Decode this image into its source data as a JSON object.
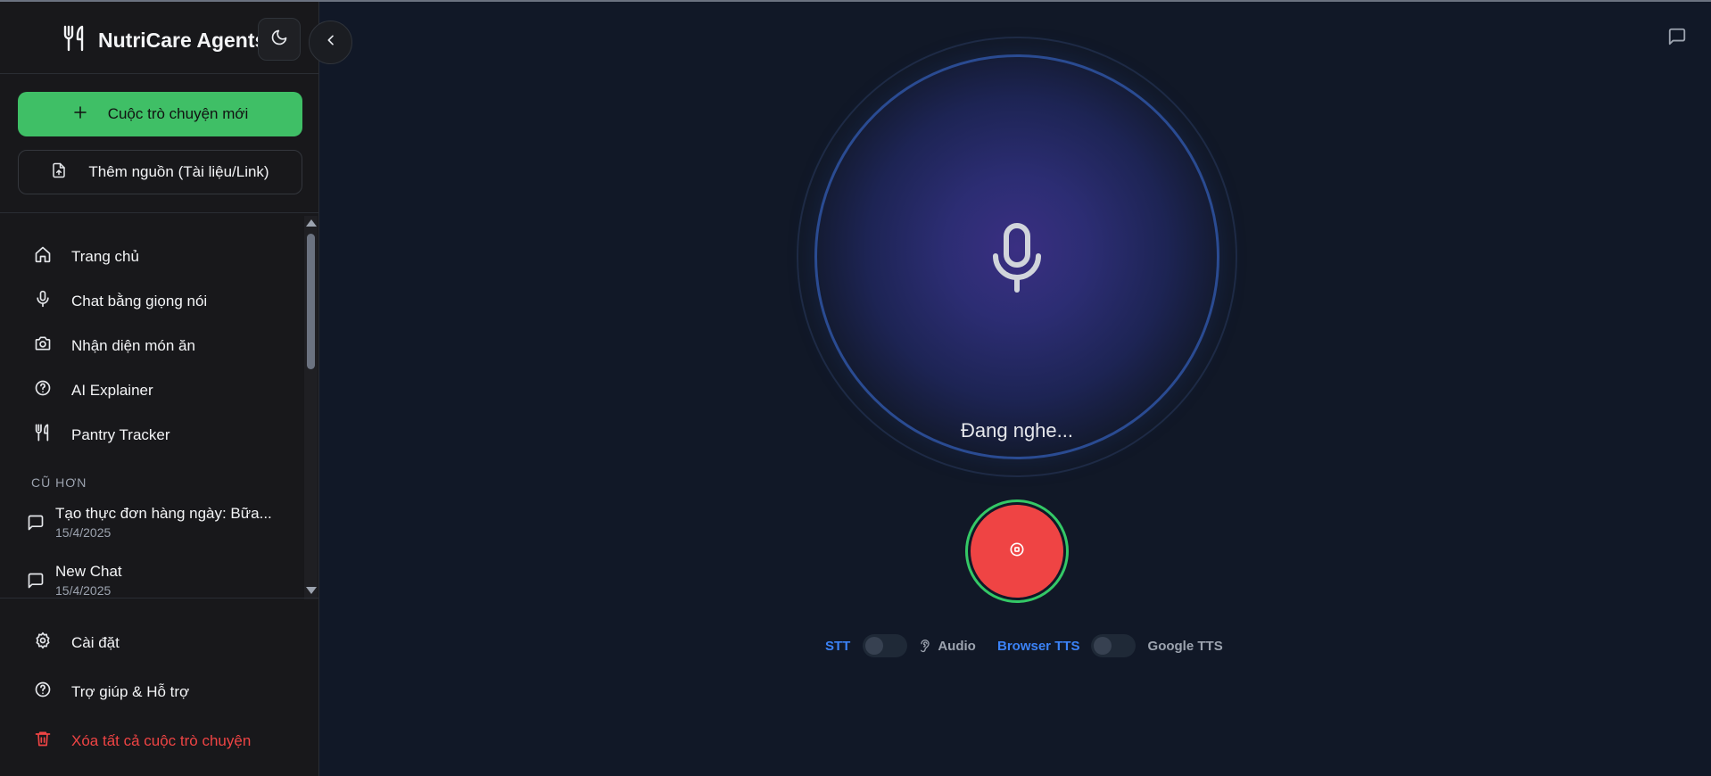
{
  "app": {
    "title": "NutriCare Agents"
  },
  "sidebar": {
    "new_chat_label": "Cuộc trò chuyện mới",
    "add_source_label": "Thêm nguồn (Tài liệu/Link)",
    "nav": [
      {
        "label": "Trang chủ",
        "icon": "home-icon"
      },
      {
        "label": "Chat bằng giọng nói",
        "icon": "microphone-icon"
      },
      {
        "label": "Nhận diện món ăn",
        "icon": "camera-icon"
      },
      {
        "label": "AI Explainer",
        "icon": "help-circle-icon"
      },
      {
        "label": "Pantry Tracker",
        "icon": "utensils-icon"
      }
    ],
    "section_older": "CŨ HƠN",
    "chats": [
      {
        "title": "Tạo thực đơn hàng ngày: Bữa...",
        "date": "15/4/2025"
      },
      {
        "title": "New Chat",
        "date": "15/4/2025"
      }
    ],
    "footer": [
      {
        "label": "Cài đặt",
        "icon": "settings-icon"
      },
      {
        "label": "Trợ giúp & Hỗ trợ",
        "icon": "help-circle-icon"
      },
      {
        "label": "Xóa tất cả cuộc trò chuyện",
        "icon": "trash-icon"
      }
    ]
  },
  "main": {
    "status_text": "Đang nghe...",
    "controls": {
      "stt_label": "STT",
      "audio_label": "Audio",
      "browser_tts_label": "Browser TTS",
      "google_tts_label": "Google TTS"
    }
  },
  "colors": {
    "background": "#111827",
    "sidebar": "#18181b",
    "accent_green": "#3fbf66",
    "record_red": "#ef4444",
    "accent_blue": "#3b82f6",
    "danger": "#ef4444"
  }
}
